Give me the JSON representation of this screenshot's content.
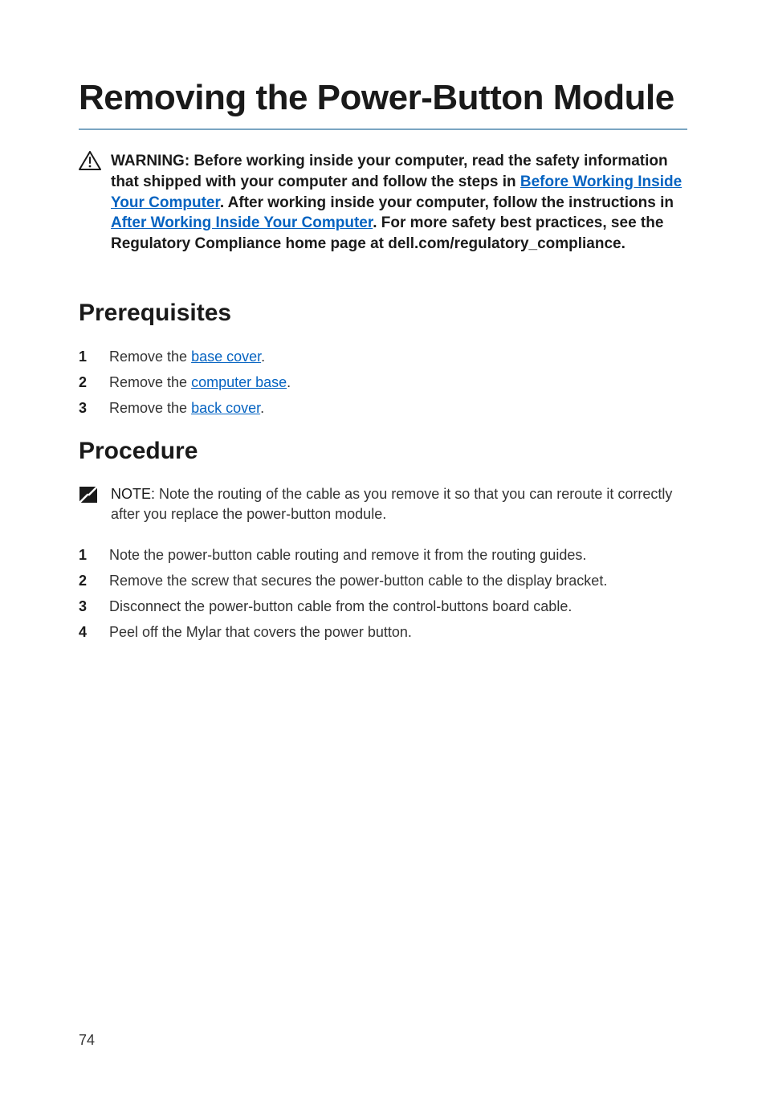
{
  "title": "Removing the Power-Button Module",
  "warning": {
    "pre": "WARNING: Before working inside your computer, read the safety information that shipped with your computer and follow the steps in ",
    "link1": "Before Working Inside Your Computer",
    "mid1": ". After working inside your computer, follow the instructions in ",
    "link2": "After Working Inside Your Computer",
    "post": ". For more safety best practices, see the Regulatory Compliance home page at dell.com/regulatory_compliance."
  },
  "sections": {
    "prerequisites": {
      "heading": "Prerequisites",
      "items": [
        {
          "num": "1",
          "pre": "Remove the ",
          "link": "base cover",
          "post": "."
        },
        {
          "num": "2",
          "pre": "Remove the ",
          "link": "computer base",
          "post": "."
        },
        {
          "num": "3",
          "pre": "Remove the ",
          "link": "back cover",
          "post": "."
        }
      ]
    },
    "procedure": {
      "heading": "Procedure",
      "note": {
        "label": "NOTE:",
        "text": " Note the routing of the cable as you remove it so that you can reroute it correctly after you replace the power-button module."
      },
      "items": [
        {
          "num": "1",
          "text": "Note the power-button cable routing and remove it from the routing guides."
        },
        {
          "num": "2",
          "text": "Remove the screw that secures the power-button cable to the display bracket."
        },
        {
          "num": "3",
          "text": "Disconnect the power-button cable from the control-buttons board cable."
        },
        {
          "num": "4",
          "text": "Peel off the Mylar that covers the power button."
        }
      ]
    }
  },
  "pageNumber": "74"
}
